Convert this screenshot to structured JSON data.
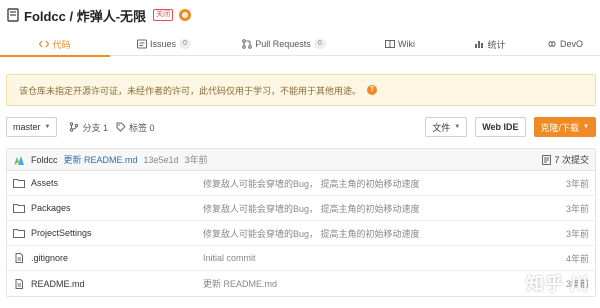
{
  "header": {
    "title": "Foldcc / 炸弹人-无限",
    "badge": "关闭"
  },
  "tabs": [
    {
      "label": "代码",
      "icon": "code-icon",
      "active": true
    },
    {
      "label": "Issues",
      "count": "0",
      "icon": "issues-icon"
    },
    {
      "label": "Pull Requests",
      "count": "0",
      "icon": "pull-request-icon"
    },
    {
      "label": "Wiki",
      "icon": "wiki-icon"
    },
    {
      "label": "统计",
      "icon": "stats-icon"
    },
    {
      "label": "DevO",
      "icon": "devops-icon"
    }
  ],
  "warning": {
    "text": "该仓库未指定开源许可证，未经作者的许可，此代码仅用于学习，不能用于其他用途。",
    "help": "?"
  },
  "toolbar": {
    "branch": "master",
    "branches_label": "分支 1",
    "tags_label": "标签 0",
    "file_button": "文件",
    "webide_button": "Web IDE",
    "clone_button": "克隆/下载"
  },
  "commit": {
    "author": "Foldcc",
    "message": "更新 README.md",
    "hash": "13e5e1d",
    "time": "3年前",
    "commits_label": "7 次提交"
  },
  "files": [
    {
      "name": "Assets",
      "type": "folder",
      "message": "修复敌人可能会穿墙的Bug，  提高主角的初始移动速度",
      "time": "3年前"
    },
    {
      "name": "Packages",
      "type": "folder",
      "message": "修复敌人可能会穿墙的Bug，  提高主角的初始移动速度",
      "time": "3年前"
    },
    {
      "name": "ProjectSettings",
      "type": "folder",
      "message": "修复敌人可能会穿墙的Bug，  提高主角的初始移动速度",
      "time": "3年前"
    },
    {
      "name": ".gitignore",
      "type": "file",
      "message": "Initial commit",
      "time": "4年前"
    },
    {
      "name": "README.md",
      "type": "file",
      "message": "更新 README.md",
      "time": "3年前"
    }
  ],
  "watermark": "知乎 川",
  "colors": {
    "accent": "#f08a24",
    "link": "#2f6fb0",
    "warning_bg": "#fdf6e2"
  }
}
